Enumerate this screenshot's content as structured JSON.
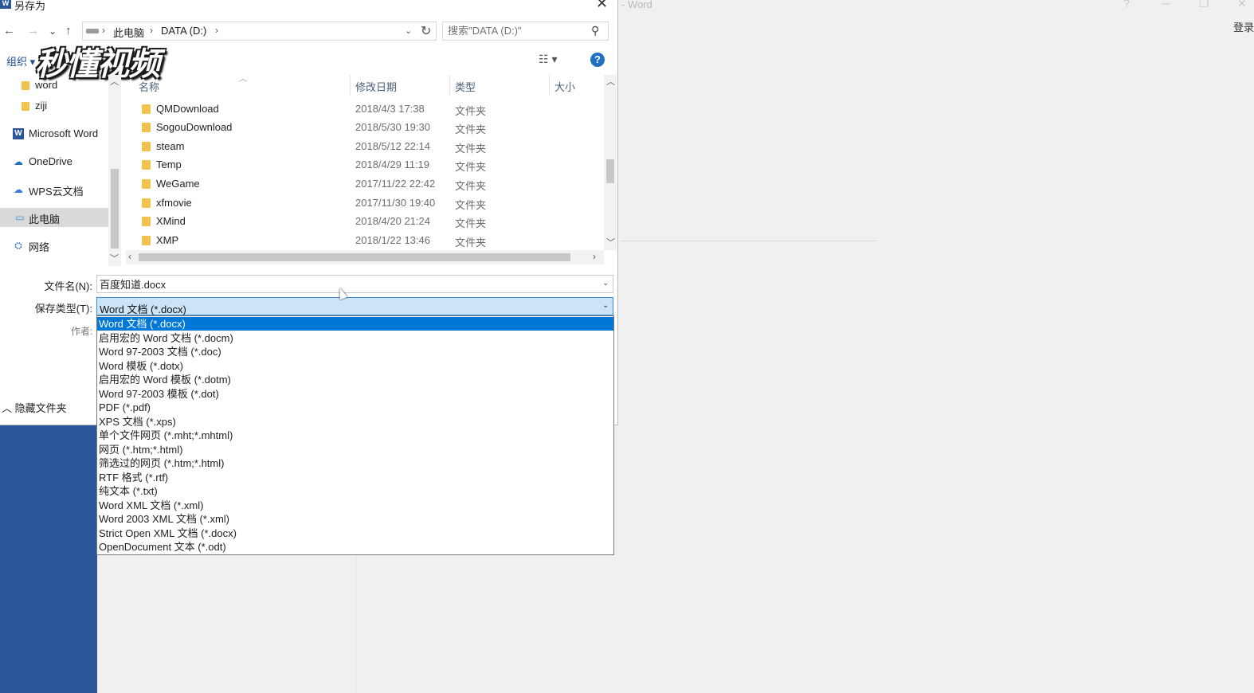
{
  "word_window": {
    "title": "- Word",
    "sign_in": "登录",
    "controls": [
      "?",
      "─",
      "❐",
      "✕"
    ]
  },
  "dialog": {
    "title": "另存为",
    "title_icon": "W",
    "close_icon": "✕",
    "nav": {
      "back_icon": "←",
      "forward_icon": "→",
      "recent_icon": "⌄",
      "up_icon": "↑",
      "breadcrumbs": [
        "此电脑",
        "DATA (D:)"
      ],
      "separator": "›",
      "dropdown_icon": "⌄",
      "refresh_icon": "↻"
    },
    "search": {
      "placeholder": "搜索\"DATA (D:)\"",
      "icon": "⚲"
    },
    "toolbar": {
      "organize_label": "组织 ▾",
      "view_icon": "☷ ▾",
      "help_icon": "?"
    },
    "watermark": "秒懂视频",
    "nav_pane": {
      "items": [
        {
          "label": "word",
          "icon": "folder-icon"
        },
        {
          "label": "ziji",
          "icon": "folder-icon"
        },
        {
          "label": "Microsoft Word",
          "icon": "word-app-icon",
          "glyph": "W"
        },
        {
          "label": "OneDrive",
          "icon": "cloud-icon",
          "glyph": "☁"
        },
        {
          "label": "WPS云文档",
          "icon": "wps-cloud-icon",
          "glyph": "☁"
        },
        {
          "label": "此电脑",
          "icon": "computer-icon",
          "glyph": "▭"
        },
        {
          "label": "网络",
          "icon": "network-icon",
          "glyph": "⛭"
        }
      ],
      "selected_index": 5
    },
    "file_list": {
      "columns": [
        "名称",
        "修改日期",
        "类型",
        "大小"
      ],
      "rows": [
        {
          "name": "QMDownload",
          "date": "2018/4/3 17:38",
          "type": "文件夹"
        },
        {
          "name": "SogouDownload",
          "date": "2018/5/30 19:30",
          "type": "文件夹"
        },
        {
          "name": "steam",
          "date": "2018/5/12 22:14",
          "type": "文件夹"
        },
        {
          "name": "Temp",
          "date": "2018/4/29 11:19",
          "type": "文件夹"
        },
        {
          "name": "WeGame",
          "date": "2017/11/22 22:42",
          "type": "文件夹"
        },
        {
          "name": "xfmovie",
          "date": "2017/11/30 19:40",
          "type": "文件夹"
        },
        {
          "name": "XMind",
          "date": "2018/4/20 21:24",
          "type": "文件夹"
        },
        {
          "name": "XMP",
          "date": "2018/1/22 13:46",
          "type": "文件夹"
        }
      ]
    },
    "form": {
      "filename_label": "文件名(N):",
      "filename_value": "百度知道.docx",
      "savetype_label": "保存类型(T):",
      "savetype_value": "Word 文档 (*.docx)",
      "author_label": "作者:",
      "hide_folders_label": "隐藏文件夹",
      "caret_icon": "⌄"
    },
    "savetype_options": [
      "Word 文档 (*.docx)",
      "启用宏的 Word 文档 (*.docm)",
      "Word 97-2003 文档 (*.doc)",
      "Word 模板 (*.dotx)",
      "启用宏的 Word 模板 (*.dotm)",
      "Word 97-2003 模板 (*.dot)",
      "PDF (*.pdf)",
      "XPS 文档 (*.xps)",
      "单个文件网页 (*.mht;*.mhtml)",
      "网页 (*.htm;*.html)",
      "筛选过的网页 (*.htm;*.html)",
      "RTF 格式 (*.rtf)",
      "纯文本 (*.txt)",
      "Word XML 文档 (*.xml)",
      "Word 2003 XML 文档 (*.xml)",
      "Strict Open XML 文档 (*.docx)",
      "OpenDocument 文本 (*.odt)"
    ],
    "selected_option_index": 0
  },
  "colors": {
    "word_blue": "#2b579a",
    "selection_blue": "#0078d7",
    "select_highlight": "#cce4f7",
    "folder_yellow": "#f2c14e"
  }
}
